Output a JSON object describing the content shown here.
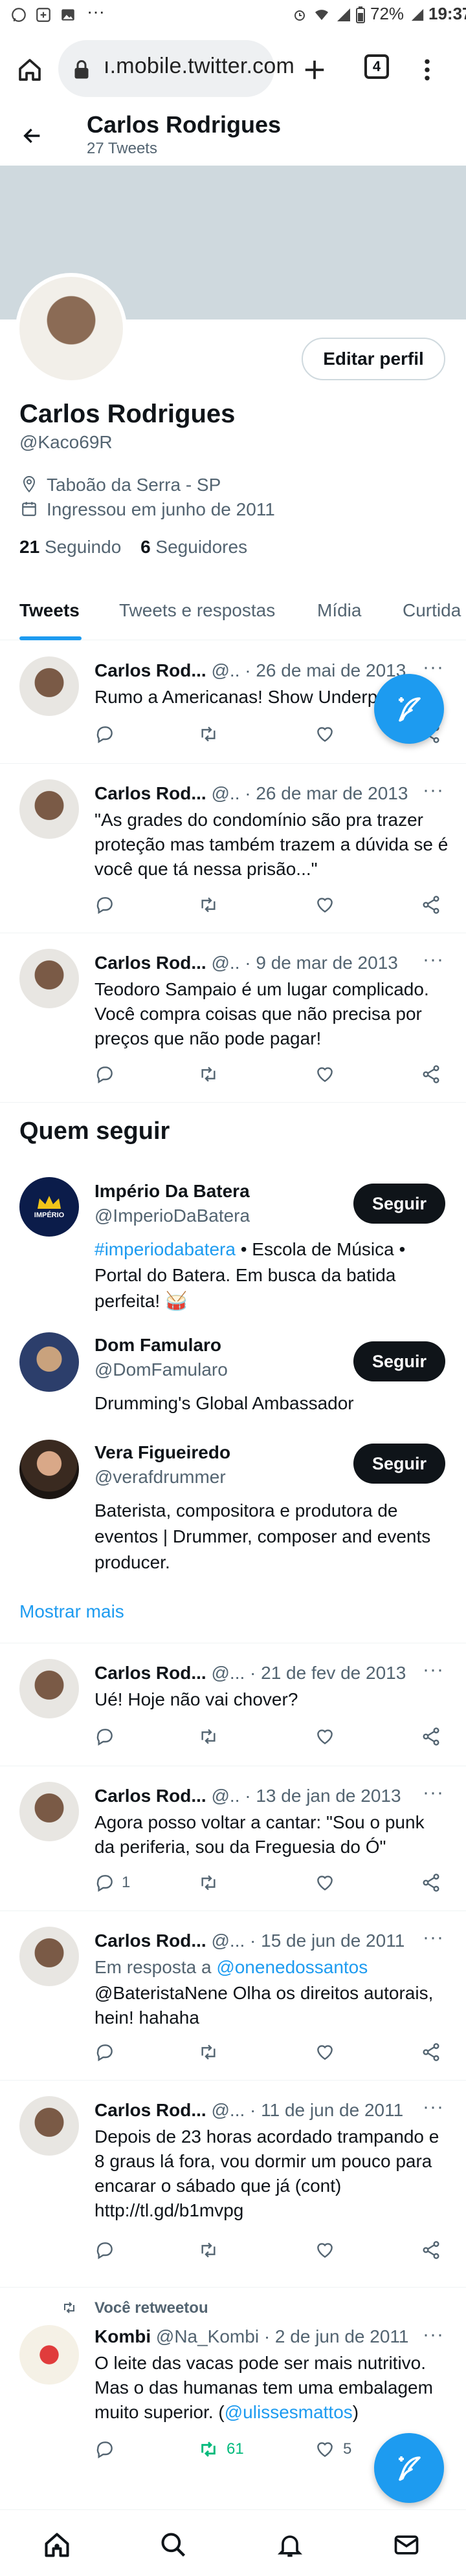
{
  "status_bar": {
    "battery": "72%",
    "time": "19:37"
  },
  "browser": {
    "url": "ı.mobile.twitter.com",
    "tab_count": "4"
  },
  "header": {
    "name": "Carlos Rodrigues",
    "tweet_count": "27 Tweets"
  },
  "profile": {
    "edit_label": "Editar perfil",
    "name": "Carlos Rodrigues",
    "handle": "@Kaco69R",
    "location": "Taboão da Serra - SP",
    "joined": "Ingressou em junho de 2011",
    "following_count": "21",
    "following_label": "Seguindo",
    "followers_count": "6",
    "followers_label": "Seguidores"
  },
  "tabs": [
    "Tweets",
    "Tweets e respostas",
    "Mídia",
    "Curtida"
  ],
  "tweets_top": [
    {
      "name": "Carlos Rod...",
      "handle": "@..",
      "date": "· 26 de mai de 2013",
      "text": "Rumo a Americanas! Show Underp"
    },
    {
      "name": "Carlos Rod...",
      "handle": "@..",
      "date": "· 26 de mar de 2013",
      "text": "\"As grades do condomínio são pra trazer proteção mas também trazem a dúvida se é você que tá nessa prisão...\""
    },
    {
      "name": "Carlos Rod...",
      "handle": "@..",
      "date": "· 9 de mar de 2013",
      "text": "Teodoro Sampaio é um lugar complicado. Você compra coisas que não precisa por preços que não pode pagar!"
    }
  ],
  "who_to_follow": {
    "title": "Quem seguir",
    "follow_label": "Seguir",
    "show_more": "Mostrar mais",
    "accounts": [
      {
        "name": "Império Da Batera",
        "handle": "@ImperioDaBatera",
        "hashtag": "#imperiodabatera",
        "bio": " • Escola de Música • Portal do Batera. Em busca da batida perfeita! 🥁",
        "avatar_text": "IMPÉRIO"
      },
      {
        "name": "Dom Famularo",
        "handle": "@DomFamularo",
        "bio": "Drumming's Global Ambassador"
      },
      {
        "name": "Vera Figueiredo",
        "handle": "@verafdrummer",
        "bio": "Baterista, compositora e produtora de eventos | Drummer, composer and events producer."
      }
    ]
  },
  "tweets_bottom": [
    {
      "name": "Carlos Rod...",
      "handle": "@...",
      "date": "· 21 de fev de 2013",
      "text": "Ué! Hoje não vai chover?"
    },
    {
      "name": "Carlos Rod...",
      "handle": "@..",
      "date": "· 13 de jan de 2013",
      "text": "Agora posso voltar a cantar: \"Sou o punk da periferia, sou da Freguesia do Ó\"",
      "reply_count": "1"
    },
    {
      "name": "Carlos Rod...",
      "handle": "@...",
      "date": "· 15 de jun de 2011",
      "reply_prefix": "Em resposta a ",
      "reply_to": "@onenedossantos",
      "text": "@BateristaNene Olha os direitos autorais, hein! hahaha"
    },
    {
      "name": "Carlos Rod...",
      "handle": "@...",
      "date": "· 11 de jun de 2011",
      "text": "Depois de 23 horas acordado trampando e 8 graus lá fora, vou dormir um pouco para encarar o sábado que já (cont) http://tl.gd/b1mvpg"
    }
  ],
  "retweet": {
    "label": "Você retweetou",
    "name": "Kombi",
    "handle": "@Na_Kombi",
    "date": "· 2 de jun de 2011",
    "text": "O leite das vacas pode ser mais nutritivo. Mas o das humanas tem uma embalagem muito superior. (",
    "mention": "@ulissesmattos",
    "text_end": ")",
    "retweet_count": "61",
    "like_count": "5"
  },
  "colors": {
    "accent": "#1d9bf0",
    "retweet_green": "#00ba7c",
    "banner": "#cfd9de"
  }
}
